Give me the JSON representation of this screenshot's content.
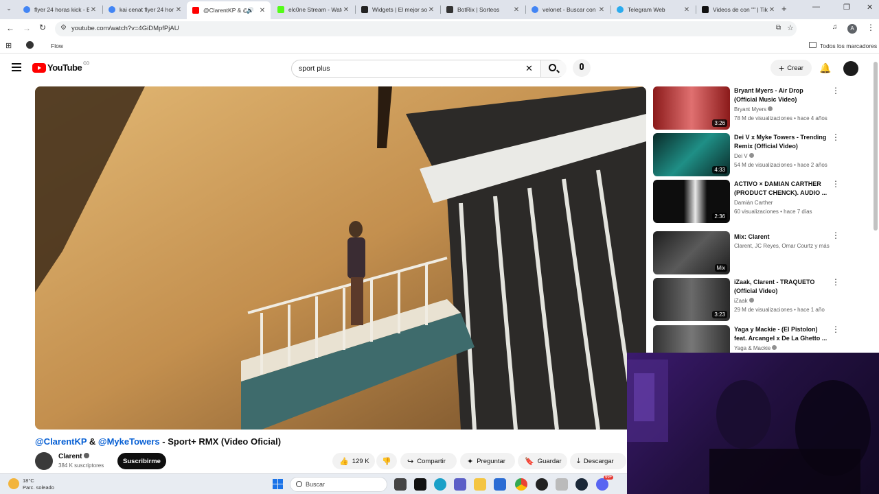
{
  "browser": {
    "tabs": [
      {
        "title": "flyer 24 horas kick - B",
        "favicon_color": "#4285f4"
      },
      {
        "title": "kai cenat flyer 24 hor",
        "favicon_color": "#4285f4"
      },
      {
        "title": "@ClarentKP & @",
        "favicon_color": "#ff0000",
        "active": true
      },
      {
        "title": "elc0ne Stream - Watc",
        "favicon_color": "#53fc18"
      },
      {
        "title": "Widgets | El mejor so",
        "favicon_color": "#222222"
      },
      {
        "title": "BotRix | Sorteos",
        "favicon_color": "#333333"
      },
      {
        "title": "velonet - Buscar con",
        "favicon_color": "#4285f4"
      },
      {
        "title": "Telegram Web",
        "favicon_color": "#2aabee"
      },
      {
        "title": "Videos de con \"\" | Tik",
        "favicon_color": "#111111"
      }
    ],
    "url": "youtube.com/watch?v=4GiDMpfPjAU",
    "bookmark_flow": "Flow",
    "bookmarks_all": "Todos los marcadores",
    "profile_initial": "A"
  },
  "youtube": {
    "logo_text": "YouTube",
    "country": "CO",
    "search_value": "sport plus",
    "create_label": "Crear"
  },
  "video": {
    "title_mention1": "@ClarentKP",
    "title_amp": " & ",
    "title_mention2": "@MykeTowers",
    "title_rest": " - Sport+ RMX (Video Oficial)",
    "channel_name": "Clarent",
    "subscribers": "384 K suscriptores",
    "subscribe_label": "Suscribirme",
    "likes": "129 K",
    "share_label": "Compartir",
    "ask_label": "Preguntar",
    "save_label": "Guardar",
    "download_label": "Descargar"
  },
  "recommendations": [
    {
      "title": "Bryant Myers - Air Drop (Official Music Video)",
      "channel": "Bryant Myers",
      "meta": "78 M de visualizaciones • hace 4 años",
      "duration": "3:26",
      "verified": true,
      "thumb": "#c0392b"
    },
    {
      "title": "Dei V x Myke Towers - Trending Remix (Official Video)",
      "channel": "Dei V",
      "meta": "54 M de visualizaciones • hace 2 años",
      "duration": "4:33",
      "verified": true,
      "thumb": "#0f5e57"
    },
    {
      "title": "ACTIVO × DAMIAN CARTHER (PRODUCT CHENCK). AUDIO ...",
      "channel": "Damián Carther",
      "meta": "60 visualizaciones • hace 7 días",
      "duration": "2:36",
      "verified": false,
      "thumb": "#1a1a1a"
    },
    {
      "title": "Mix: Clarent",
      "channel": "Clarent, JC Reyes, Omar Courtz y más",
      "meta": "",
      "duration": "Mix",
      "verified": false,
      "thumb": "#2b2b2b"
    },
    {
      "title": "iZaak, Clarent - TRAQUETO (Official Video)",
      "channel": "iZaak",
      "meta": "29 M de visualizaciones • hace 1 año",
      "duration": "3:23",
      "verified": true,
      "thumb": "#3a3a3a"
    },
    {
      "title": "Yaga y Mackie - (El Pistolon) feat. Arcangel x De La Ghetto ...",
      "channel": "Yaga & Mackie",
      "meta": "",
      "duration": "",
      "verified": true,
      "thumb": "#444444"
    }
  ],
  "taskbar": {
    "temperature": "18°C",
    "weather": "Parc. soleado",
    "search_placeholder": "Buscar",
    "notification_count": "99+"
  }
}
